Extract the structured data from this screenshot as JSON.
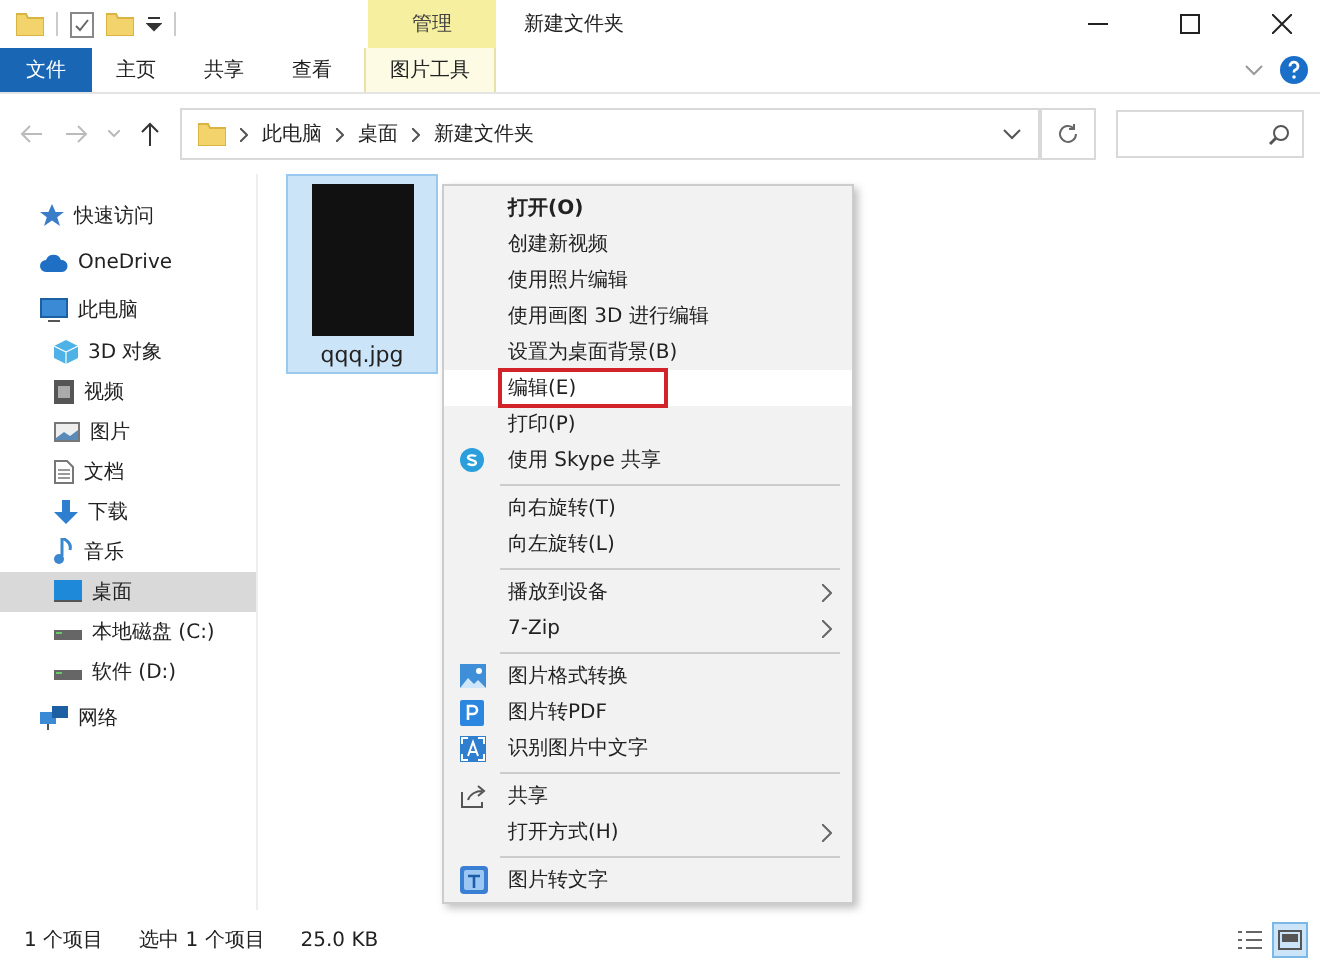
{
  "window": {
    "title": "新建文件夹",
    "context_tab": "管理"
  },
  "ribbon": {
    "tabs": [
      {
        "label": "文件",
        "kind": "file",
        "selected": false
      },
      {
        "label": "主页",
        "kind": "tab",
        "selected": false
      },
      {
        "label": "共享",
        "kind": "tab",
        "selected": false
      },
      {
        "label": "查看",
        "kind": "tab",
        "selected": false
      },
      {
        "label": "图片工具",
        "kind": "context",
        "selected": false
      }
    ]
  },
  "address_bar": {
    "path": [
      "此电脑",
      "桌面",
      "新建文件夹"
    ]
  },
  "sidebar": {
    "items": [
      {
        "label": "快速访问",
        "kind": "star",
        "selected": false
      },
      {
        "label": "OneDrive",
        "kind": "cloud",
        "selected": false
      },
      {
        "label": "此电脑",
        "kind": "pc",
        "selected": false,
        "children": [
          {
            "label": "3D 对象",
            "kind": "cube",
            "selected": false
          },
          {
            "label": "视频",
            "kind": "video",
            "selected": false
          },
          {
            "label": "图片",
            "kind": "picture",
            "selected": false
          },
          {
            "label": "文档",
            "kind": "doc",
            "selected": false
          },
          {
            "label": "下载",
            "kind": "download",
            "selected": false
          },
          {
            "label": "音乐",
            "kind": "music",
            "selected": false
          },
          {
            "label": "桌面",
            "kind": "desktop",
            "selected": true
          },
          {
            "label": "本地磁盘 (C:)",
            "kind": "drive",
            "selected": false
          },
          {
            "label": "软件 (D:)",
            "kind": "drive",
            "selected": false
          }
        ]
      },
      {
        "label": "网络",
        "kind": "network",
        "selected": false
      }
    ]
  },
  "files": [
    {
      "name": "qqq.jpg",
      "selected": true
    }
  ],
  "context_menu": {
    "groups": [
      [
        {
          "label": "打开(O)",
          "kind": "plain",
          "default": true,
          "highlighted": false,
          "annotated": false,
          "submenu": false
        },
        {
          "label": "创建新视频",
          "kind": "plain",
          "default": false,
          "highlighted": false,
          "annotated": false,
          "submenu": false
        },
        {
          "label": "使用照片编辑",
          "kind": "plain",
          "default": false,
          "highlighted": false,
          "annotated": false,
          "submenu": false
        },
        {
          "label": "使用画图 3D 进行编辑",
          "kind": "plain",
          "default": false,
          "highlighted": false,
          "annotated": false,
          "submenu": false
        },
        {
          "label": "设置为桌面背景(B)",
          "kind": "plain",
          "default": false,
          "highlighted": false,
          "annotated": false,
          "submenu": false
        },
        {
          "label": "编辑(E)",
          "kind": "plain",
          "default": false,
          "highlighted": true,
          "annotated": true,
          "submenu": false
        },
        {
          "label": "打印(P)",
          "kind": "plain",
          "default": false,
          "highlighted": false,
          "annotated": false,
          "submenu": false
        },
        {
          "label": "使用 Skype 共享",
          "kind": "skype",
          "default": false,
          "highlighted": false,
          "annotated": false,
          "submenu": false
        }
      ],
      [
        {
          "label": "向右旋转(T)",
          "kind": "plain",
          "default": false,
          "highlighted": false,
          "annotated": false,
          "submenu": false
        },
        {
          "label": "向左旋转(L)",
          "kind": "plain",
          "default": false,
          "highlighted": false,
          "annotated": false,
          "submenu": false
        }
      ],
      [
        {
          "label": "播放到设备",
          "kind": "plain",
          "default": false,
          "highlighted": false,
          "annotated": false,
          "submenu": true
        },
        {
          "label": "7-Zip",
          "kind": "plain",
          "default": false,
          "highlighted": false,
          "annotated": false,
          "submenu": true
        }
      ],
      [
        {
          "label": "图片格式转换",
          "kind": "image",
          "default": false,
          "highlighted": false,
          "annotated": false,
          "submenu": false
        },
        {
          "label": "图片转PDF",
          "kind": "pdf",
          "default": false,
          "highlighted": false,
          "annotated": false,
          "submenu": false
        },
        {
          "label": "识别图片中文字",
          "kind": "ocr",
          "default": false,
          "highlighted": false,
          "annotated": false,
          "submenu": false
        }
      ],
      [
        {
          "label": "共享",
          "kind": "share",
          "default": false,
          "highlighted": false,
          "annotated": false,
          "submenu": false
        },
        {
          "label": "打开方式(H)",
          "kind": "plain",
          "default": false,
          "highlighted": false,
          "annotated": false,
          "submenu": true
        }
      ],
      [
        {
          "label": "图片转文字",
          "kind": "text-ocr",
          "default": false,
          "highlighted": false,
          "annotated": false,
          "submenu": false
        }
      ]
    ]
  },
  "status_bar": {
    "items": [
      "1 个项目",
      "选中 1 个项目",
      "25.0 KB"
    ],
    "views": [
      {
        "kind": "details",
        "selected": false
      },
      {
        "kind": "large-icons",
        "selected": true
      }
    ]
  }
}
